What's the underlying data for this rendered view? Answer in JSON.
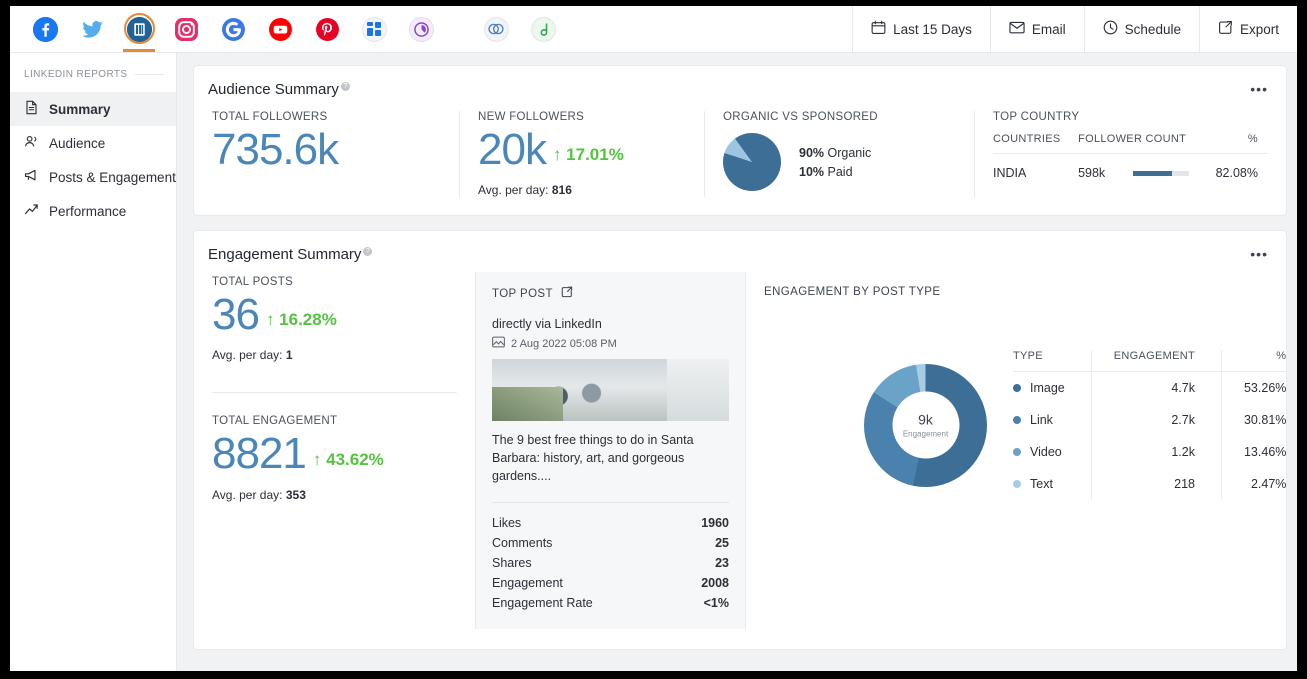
{
  "channels": [
    {
      "name": "facebook",
      "letter": "f",
      "color": "#1877f2"
    },
    {
      "name": "twitter",
      "letter": "t",
      "color": "#55acee"
    },
    {
      "name": "linkedin",
      "letter": "in",
      "color": "#1f6397",
      "active": true
    },
    {
      "name": "instagram",
      "letter": "o",
      "color": "#e1306c"
    },
    {
      "name": "google",
      "letter": "G",
      "color": "#3b78e7"
    },
    {
      "name": "youtube",
      "letter": "▶",
      "color": "#ff0000"
    },
    {
      "name": "pinterest",
      "letter": "P",
      "color": "#e60023"
    },
    {
      "name": "google-business",
      "letter": "▦",
      "color": "#1a73e8"
    },
    {
      "name": "analytics",
      "letter": "◔",
      "color": "#8e44d0"
    },
    {
      "name": "links",
      "letter": "∞",
      "color": "#4a7fc1"
    },
    {
      "name": "custom",
      "letter": "✓",
      "color": "#34a853"
    }
  ],
  "toolbar": {
    "date_range": "Last 15 Days",
    "email": "Email",
    "schedule": "Schedule",
    "export": "Export"
  },
  "sidebar": {
    "section_title": "LINKEDIN REPORTS",
    "items": [
      {
        "label": "Summary",
        "icon": "document-icon",
        "active": true
      },
      {
        "label": "Audience",
        "icon": "people-icon",
        "active": false
      },
      {
        "label": "Posts & Engagement",
        "icon": "megaphone-icon",
        "active": false
      },
      {
        "label": "Performance",
        "icon": "trending-up-icon",
        "active": false
      }
    ]
  },
  "audience_summary": {
    "title": "Audience Summary",
    "total_followers": {
      "label": "Total Followers",
      "value": "735.6k"
    },
    "new_followers": {
      "label": "New Followers",
      "value": "20k",
      "delta": "↑ 17.01%",
      "avg_label": "Avg. per day:",
      "avg_value": "816"
    },
    "organic_vs_sponsored": {
      "label": "Organic vs Sponsored",
      "slices": [
        {
          "name": "Organic",
          "percent": "90%",
          "value": 90,
          "color": "#3d6e96"
        },
        {
          "name": "Paid",
          "percent": "10%",
          "value": 10,
          "color": "#9dc4e0"
        }
      ]
    },
    "top_country": {
      "label": "Top Country",
      "columns": [
        "Countries",
        "Follower Count",
        "%"
      ],
      "rows": [
        {
          "country": "INDIA",
          "followers": "598k",
          "percent": "82.08%",
          "bar": 82
        }
      ]
    }
  },
  "engagement_summary": {
    "title": "Engagement Summary",
    "total_posts": {
      "label": "Total Posts",
      "value": "36",
      "delta": "↑ 16.28%",
      "avg_label": "Avg. per day:",
      "avg_value": "1"
    },
    "total_engagement": {
      "label": "Total Engagement",
      "value": "8821",
      "delta": "↑ 43.62%",
      "avg_label": "Avg. per day:",
      "avg_value": "353"
    },
    "top_post": {
      "label": "Top Post",
      "source": "directly via LinkedIn",
      "date": "2 Aug 2022 05:08 PM",
      "caption": "The 9 best free things to do in Santa Barbara: history, art, and gorgeous gardens....",
      "metrics": [
        {
          "label": "Likes",
          "value": "1960"
        },
        {
          "label": "Comments",
          "value": "25"
        },
        {
          "label": "Shares",
          "value": "23"
        },
        {
          "label": "Engagement",
          "value": "2008"
        },
        {
          "label": "Engagement Rate",
          "value": "<1%"
        }
      ]
    },
    "by_post_type": {
      "label": "Engagement by Post Type",
      "center_value": "9k",
      "center_label": "Engagement",
      "columns": [
        "Type",
        "Engagement",
        "%"
      ]
    }
  },
  "chart_data": [
    {
      "type": "pie",
      "title": "ORGANIC VS SPONSORED",
      "categories": [
        "Organic",
        "Paid"
      ],
      "values": [
        90,
        10
      ],
      "colors": [
        "#3d6e96",
        "#9dc4e0"
      ],
      "legend": "right"
    },
    {
      "type": "pie",
      "title": "ENGAGEMENT BY POST TYPE",
      "categories": [
        "Image",
        "Link",
        "Video",
        "Text"
      ],
      "values": [
        53.26,
        30.81,
        13.46,
        2.47
      ],
      "raw_values": [
        "4.7k",
        "2.7k",
        "1.2k",
        "218"
      ],
      "labels": [
        "53.26%",
        "30.81%",
        "13.46%",
        "2.47%"
      ],
      "colors": [
        "#3d6e96",
        "#4a81ad",
        "#6ba2c8",
        "#a6cde4"
      ],
      "center_value": "9k",
      "center_label": "Engagement",
      "total": "9k",
      "legend": "right"
    },
    {
      "type": "bar",
      "title": "TOP COUNTRY",
      "categories": [
        "INDIA"
      ],
      "values": [
        82.08
      ],
      "raw_values": [
        "598k"
      ],
      "ylim": [
        0,
        100
      ],
      "colors": [
        "#3d6e96"
      ]
    }
  ],
  "post_type_rows": [
    {
      "type": "Image",
      "engagement": "4.7k",
      "percent": "53.26%",
      "color": "#3d6e96"
    },
    {
      "type": "Link",
      "engagement": "2.7k",
      "percent": "30.81%",
      "color": "#4a81ad"
    },
    {
      "type": "Video",
      "engagement": "1.2k",
      "percent": "13.46%",
      "color": "#6ba2c8"
    },
    {
      "type": "Text",
      "engagement": "218",
      "percent": "2.47%",
      "color": "#a6cde4"
    }
  ],
  "menu_glyph": "•••"
}
